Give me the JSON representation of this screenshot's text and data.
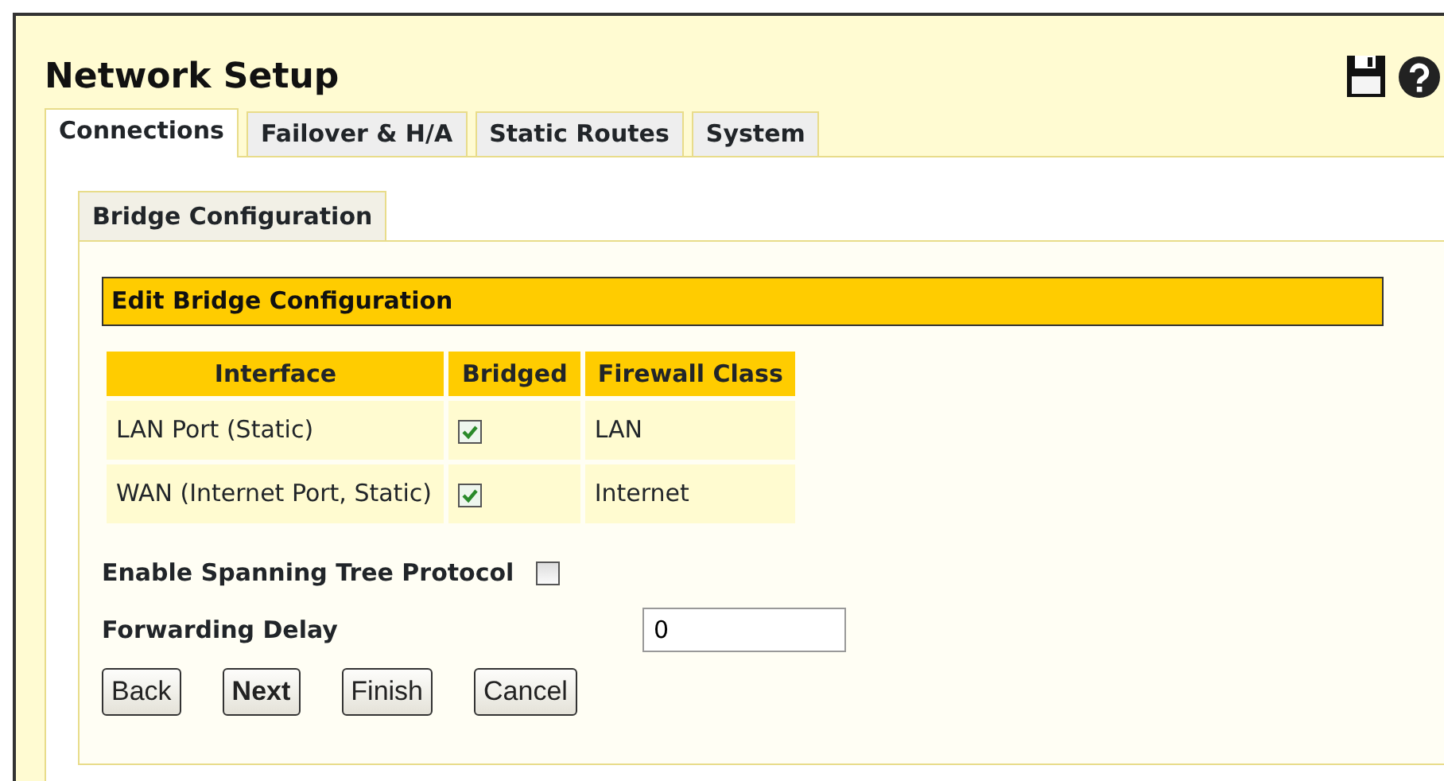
{
  "window": {
    "title": "Network Setup"
  },
  "tabs": [
    {
      "label": "Connections",
      "selected": true
    },
    {
      "label": "Failover & H/A",
      "selected": false
    },
    {
      "label": "Static Routes",
      "selected": false
    },
    {
      "label": "System",
      "selected": false
    }
  ],
  "subtabs": [
    {
      "label": "Bridge Configuration",
      "selected": true
    }
  ],
  "section_title": "Edit Bridge Configuration",
  "table": {
    "columns": [
      "Interface",
      "Bridged",
      "Firewall Class"
    ],
    "rows": [
      {
        "interface": "LAN Port (Static)",
        "bridged": true,
        "firewall_class": "LAN"
      },
      {
        "interface": "WAN (Internet Port, Static)",
        "bridged": true,
        "firewall_class": "Internet"
      }
    ]
  },
  "spanning_tree": {
    "label": "Enable Spanning Tree Protocol",
    "checked": false
  },
  "forwarding_delay": {
    "label": "Forwarding Delay",
    "value": "0"
  },
  "buttons": [
    {
      "label": "Back",
      "primary": false
    },
    {
      "label": "Next",
      "primary": true
    },
    {
      "label": "Finish",
      "primary": false
    },
    {
      "label": "Cancel",
      "primary": false
    }
  ]
}
